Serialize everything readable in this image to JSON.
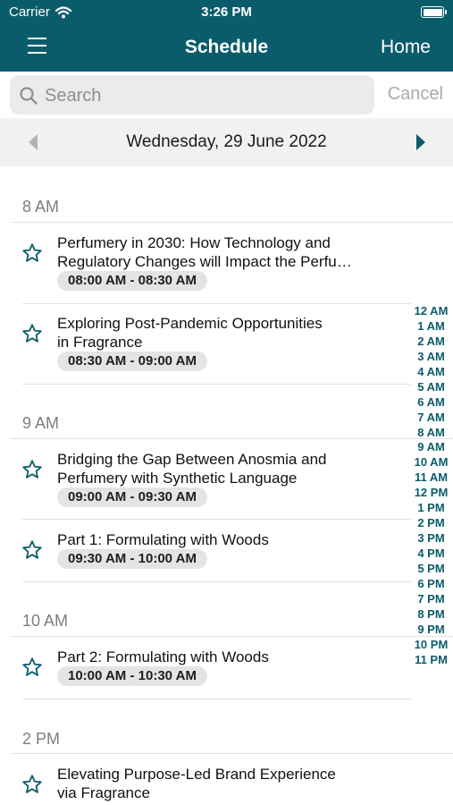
{
  "status_bar": {
    "carrier": "Carrier",
    "time": "3:26 PM"
  },
  "nav": {
    "title": "Schedule",
    "home_label": "Home"
  },
  "search": {
    "placeholder": "Search",
    "value": "",
    "cancel_label": "Cancel"
  },
  "date_nav": {
    "date": "Wednesday, 29 June 2022"
  },
  "sections": [
    {
      "header": "8 AM",
      "sessions": [
        {
          "title_line1": "Perfumery in 2030: How Technology and",
          "title_line2": "Regulatory Changes will Impact the Perfu…",
          "time": "08:00 AM - 08:30 AM",
          "favorite": false
        },
        {
          "title_line1": "Exploring Post-Pandemic Opportunities",
          "title_line2": "in Fragrance",
          "time": "08:30 AM - 09:00 AM",
          "favorite": false
        }
      ]
    },
    {
      "header": "9 AM",
      "sessions": [
        {
          "title_line1": "Bridging the Gap Between Anosmia and",
          "title_line2": "Perfumery with Synthetic Language",
          "time": "09:00 AM - 09:30 AM",
          "favorite": false
        },
        {
          "title_line1": "Part 1: Formulating with Woods",
          "title_line2": "",
          "time": "09:30 AM - 10:00 AM",
          "favorite": false
        }
      ]
    },
    {
      "header": "10 AM",
      "sessions": [
        {
          "title_line1": "Part 2: Formulating with Woods",
          "title_line2": "",
          "time": "10:00 AM - 10:30 AM",
          "favorite": false
        }
      ]
    },
    {
      "header": "2 PM",
      "sessions": [
        {
          "title_line1": "Elevating Purpose-Led Brand Experience",
          "title_line2": "via Fragrance",
          "time": "",
          "favorite": false
        }
      ]
    }
  ],
  "index_bar": [
    "12 AM",
    "1 AM",
    "2 AM",
    "3 AM",
    "4 AM",
    "5 AM",
    "6 AM",
    "7 AM",
    "8 AM",
    "9 AM",
    "10 AM",
    "11 AM",
    "12 PM",
    "1 PM",
    "2 PM",
    "3 PM",
    "4 PM",
    "5 PM",
    "6 PM",
    "7 PM",
    "8 PM",
    "9 PM",
    "10 PM",
    "11 PM"
  ],
  "colors": {
    "brand": "#0b5c6b",
    "index_text": "#0b5c6b",
    "pill_bg": "#e4e4e4",
    "section_text": "#7d7d7d"
  },
  "icons": {
    "menu": "hamburger-icon",
    "search": "search-icon",
    "prev": "chevron-left-icon",
    "next": "chevron-right-icon",
    "favorite": "star-outline-icon",
    "wifi": "wifi-icon",
    "battery": "battery-icon"
  }
}
